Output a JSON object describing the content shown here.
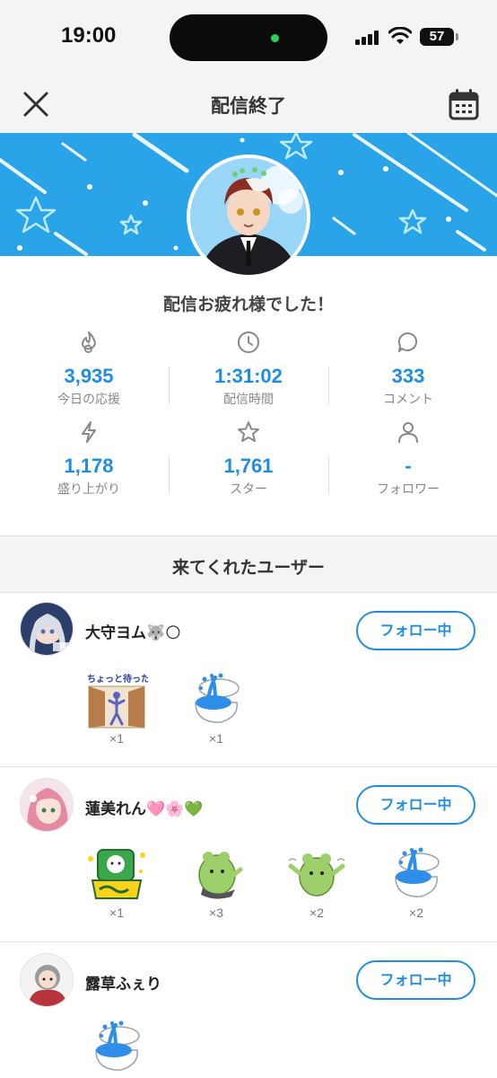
{
  "status_bar": {
    "time": "19:00",
    "battery": "57"
  },
  "header": {
    "title": "配信終了"
  },
  "message": "配信お疲れ様でした！",
  "stats": [
    {
      "icon": "flame-icon",
      "value": "3,935",
      "label": "今日の応援"
    },
    {
      "icon": "clock-icon",
      "value": "1:31:02",
      "label": "配信時間"
    },
    {
      "icon": "comment-icon",
      "value": "333",
      "label": "コメント"
    },
    {
      "icon": "bolt-icon",
      "value": "1,178",
      "label": "盛り上がり"
    },
    {
      "icon": "star-icon",
      "value": "1,761",
      "label": "スター"
    },
    {
      "icon": "person-icon",
      "value": "-",
      "label": "フォロワー"
    }
  ],
  "visitors": {
    "title": "来てくれたユーザー",
    "users": [
      {
        "name": "大守ヨム🐺🌕",
        "follow_label": "フォロー中",
        "gifts": [
          {
            "icon": "door-sticker-icon",
            "count": "×1",
            "sticker_text": "ちょっと待ったぁ!!"
          },
          {
            "icon": "toilet-fountain-icon",
            "count": "×1"
          }
        ]
      },
      {
        "name": "蓮美れん🩷🌸💚",
        "follow_label": "フォロー中",
        "gifts": [
          {
            "icon": "green-mascot-sign-icon",
            "count": "×1"
          },
          {
            "icon": "green-mascot-icon",
            "count": "×3"
          },
          {
            "icon": "green-mascot-dance-icon",
            "count": "×2"
          },
          {
            "icon": "toilet-fountain-icon",
            "count": "×2"
          }
        ]
      },
      {
        "name": "露草ふぇり",
        "follow_label": "フォロー中",
        "gifts": [
          {
            "icon": "toilet-fountain-icon",
            "count": ""
          }
        ]
      }
    ]
  },
  "colors": {
    "accent": "#1f8ee0",
    "banner": "#2aa4e8",
    "background": "#f4f4f6"
  }
}
